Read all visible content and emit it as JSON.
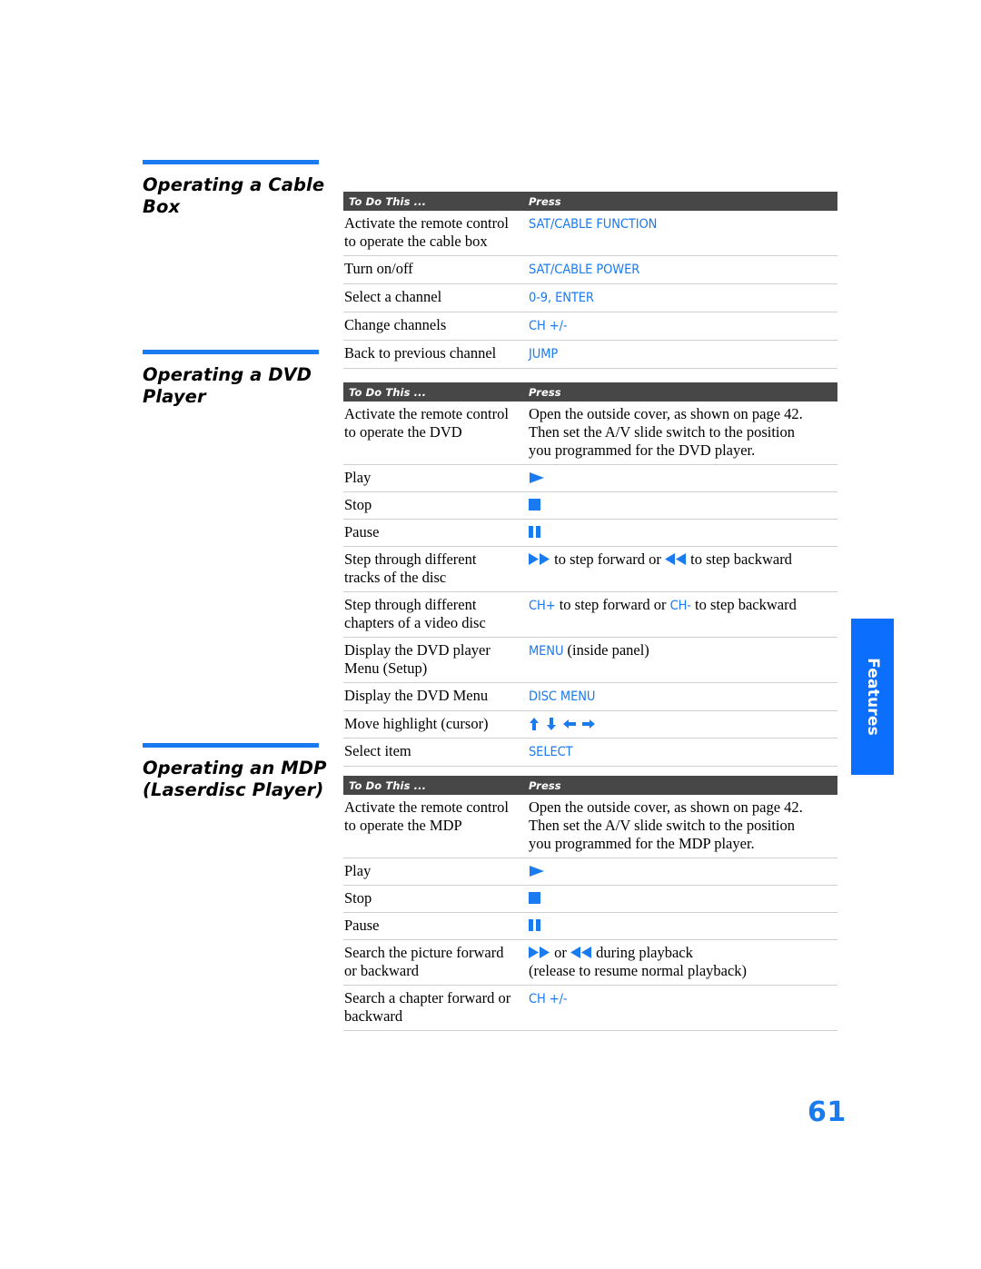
{
  "page": {
    "number": "61",
    "side_tab_label": "Features",
    "accent_color": "#1a7af0",
    "header_bg_color": "#474747"
  },
  "table_headers": {
    "col_a": "To Do This ...",
    "col_b": "Press"
  },
  "sections": [
    {
      "id": "cable",
      "heading_line1": "Operating a Cable",
      "heading_line2": "Box",
      "rows": [
        {
          "todo_line1": "Activate the remote control",
          "todo_line2": "to operate the cable box",
          "press_parts": [
            {
              "type": "key",
              "text": "SAT/CABLE FUNCTION"
            }
          ]
        },
        {
          "todo_line1": "Turn on/off",
          "todo_line2": "",
          "press_parts": [
            {
              "type": "key",
              "text": "SAT/CABLE POWER"
            }
          ]
        },
        {
          "todo_line1": "Select a channel",
          "todo_line2": "",
          "press_parts": [
            {
              "type": "key",
              "text": "0-9, ENTER"
            }
          ]
        },
        {
          "todo_line1": "Change channels",
          "todo_line2": "",
          "press_parts": [
            {
              "type": "key",
              "text": "CH +/-"
            }
          ]
        },
        {
          "todo_line1": "Back to previous channel",
          "todo_line2": "",
          "press_parts": [
            {
              "type": "key",
              "text": "JUMP"
            }
          ]
        }
      ]
    },
    {
      "id": "dvd",
      "heading_line1": "Operating a DVD",
      "heading_line2": "Player",
      "rows": [
        {
          "todo_line1": "Activate the remote control",
          "todo_line2": "to operate the DVD",
          "press_parts": [
            {
              "type": "text",
              "text": "Open the outside cover, as shown on page 42."
            },
            {
              "type": "break"
            },
            {
              "type": "text",
              "text": "Then set the A/V slide switch to the position"
            },
            {
              "type": "break"
            },
            {
              "type": "text",
              "text": "you programmed for the DVD player."
            }
          ]
        },
        {
          "todo_line1": "Play",
          "todo_line2": "",
          "press_parts": [
            {
              "type": "icon",
              "icon": "play-icon"
            }
          ]
        },
        {
          "todo_line1": "Stop",
          "todo_line2": "",
          "press_parts": [
            {
              "type": "icon",
              "icon": "stop-icon"
            }
          ]
        },
        {
          "todo_line1": "Pause",
          "todo_line2": "",
          "press_parts": [
            {
              "type": "icon",
              "icon": "pause-icon"
            }
          ]
        },
        {
          "todo_line1": "Step through different",
          "todo_line2": "tracks of the disc",
          "press_parts": [
            {
              "type": "icon",
              "icon": "fast-forward-icon"
            },
            {
              "type": "text",
              "text": " to step forward or "
            },
            {
              "type": "icon",
              "icon": "rewind-icon"
            },
            {
              "type": "text",
              "text": " to step backward"
            }
          ]
        },
        {
          "todo_line1": "Step through different",
          "todo_line2": "chapters of a video disc",
          "press_parts": [
            {
              "type": "key",
              "text": "CH+"
            },
            {
              "type": "text",
              "text": " to step forward or "
            },
            {
              "type": "key",
              "text": "CH-"
            },
            {
              "type": "text",
              "text": " to step backward"
            }
          ]
        },
        {
          "todo_line1": "Display the DVD player",
          "todo_line2": "Menu (Setup)",
          "press_parts": [
            {
              "type": "key",
              "text": "MENU"
            },
            {
              "type": "text",
              "text": " (inside panel)"
            }
          ]
        },
        {
          "todo_line1": "Display the DVD Menu",
          "todo_line2": "",
          "press_parts": [
            {
              "type": "key",
              "text": "DISC MENU"
            }
          ]
        },
        {
          "todo_line1": "Move highlight (cursor)",
          "todo_line2": "",
          "press_parts": [
            {
              "type": "icon",
              "icon": "arrow-up-icon"
            },
            {
              "type": "icon",
              "icon": "arrow-down-icon"
            },
            {
              "type": "icon",
              "icon": "arrow-left-icon"
            },
            {
              "type": "icon",
              "icon": "arrow-right-icon"
            }
          ]
        },
        {
          "todo_line1": "Select item",
          "todo_line2": "",
          "press_parts": [
            {
              "type": "key",
              "text": "SELECT"
            }
          ]
        }
      ]
    },
    {
      "id": "mdp",
      "heading_line1": "Operating an MDP",
      "heading_line2": "(Laserdisc Player)",
      "rows": [
        {
          "todo_line1": "Activate the remote control",
          "todo_line2": "to operate the MDP",
          "press_parts": [
            {
              "type": "text",
              "text": "Open the outside cover, as shown on page 42."
            },
            {
              "type": "break"
            },
            {
              "type": "text",
              "text": "Then set the A/V slide switch to the position"
            },
            {
              "type": "break"
            },
            {
              "type": "text",
              "text": "you programmed for the MDP player."
            }
          ]
        },
        {
          "todo_line1": "Play",
          "todo_line2": "",
          "press_parts": [
            {
              "type": "icon",
              "icon": "play-icon"
            }
          ]
        },
        {
          "todo_line1": "Stop",
          "todo_line2": "",
          "press_parts": [
            {
              "type": "icon",
              "icon": "stop-icon"
            }
          ]
        },
        {
          "todo_line1": "Pause",
          "todo_line2": "",
          "press_parts": [
            {
              "type": "icon",
              "icon": "pause-icon"
            }
          ]
        },
        {
          "todo_line1": "Search the picture forward",
          "todo_line2": "or backward",
          "press_parts": [
            {
              "type": "icon",
              "icon": "fast-forward-icon"
            },
            {
              "type": "text",
              "text": " or "
            },
            {
              "type": "icon",
              "icon": "rewind-icon"
            },
            {
              "type": "text",
              "text": " during playback"
            },
            {
              "type": "break"
            },
            {
              "type": "text",
              "text": "(release to resume normal playback)"
            }
          ]
        },
        {
          "todo_line1": "Search a chapter forward or",
          "todo_line2": "backward",
          "press_parts": [
            {
              "type": "key",
              "text": "CH +/-"
            }
          ]
        }
      ]
    }
  ]
}
